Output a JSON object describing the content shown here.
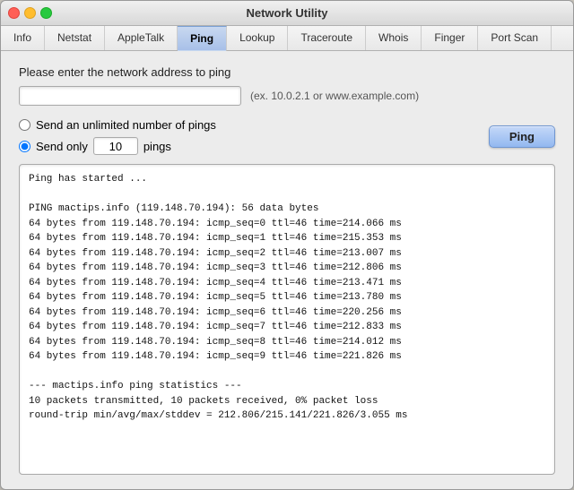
{
  "window": {
    "title": "Network Utility"
  },
  "tabs": [
    {
      "id": "info",
      "label": "Info",
      "active": false
    },
    {
      "id": "netstat",
      "label": "Netstat",
      "active": false
    },
    {
      "id": "appletalk",
      "label": "AppleTalk",
      "active": false
    },
    {
      "id": "ping",
      "label": "Ping",
      "active": true
    },
    {
      "id": "lookup",
      "label": "Lookup",
      "active": false
    },
    {
      "id": "traceroute",
      "label": "Traceroute",
      "active": false
    },
    {
      "id": "whois",
      "label": "Whois",
      "active": false
    },
    {
      "id": "finger",
      "label": "Finger",
      "active": false
    },
    {
      "id": "portscan",
      "label": "Port Scan",
      "active": false
    }
  ],
  "ping": {
    "label": "Please enter the network address to ping",
    "address_placeholder": "",
    "address_hint": "(ex. 10.0.2.1 or www.example.com)",
    "radio_unlimited_label": "Send an unlimited number of pings",
    "radio_count_prefix": "Send only",
    "radio_count_value": "10",
    "radio_count_suffix": "pings",
    "ping_button_label": "Ping",
    "output": "Ping has started ...\n\nPING mactips.info (119.148.70.194): 56 data bytes\n64 bytes from 119.148.70.194: icmp_seq=0 ttl=46 time=214.066 ms\n64 bytes from 119.148.70.194: icmp_seq=1 ttl=46 time=215.353 ms\n64 bytes from 119.148.70.194: icmp_seq=2 ttl=46 time=213.007 ms\n64 bytes from 119.148.70.194: icmp_seq=3 ttl=46 time=212.806 ms\n64 bytes from 119.148.70.194: icmp_seq=4 ttl=46 time=213.471 ms\n64 bytes from 119.148.70.194: icmp_seq=5 ttl=46 time=213.780 ms\n64 bytes from 119.148.70.194: icmp_seq=6 ttl=46 time=220.256 ms\n64 bytes from 119.148.70.194: icmp_seq=7 ttl=46 time=212.833 ms\n64 bytes from 119.148.70.194: icmp_seq=8 ttl=46 time=214.012 ms\n64 bytes from 119.148.70.194: icmp_seq=9 ttl=46 time=221.826 ms\n\n--- mactips.info ping statistics ---\n10 packets transmitted, 10 packets received, 0% packet loss\nround-trip min/avg/max/stddev = 212.806/215.141/221.826/3.055 ms"
  }
}
